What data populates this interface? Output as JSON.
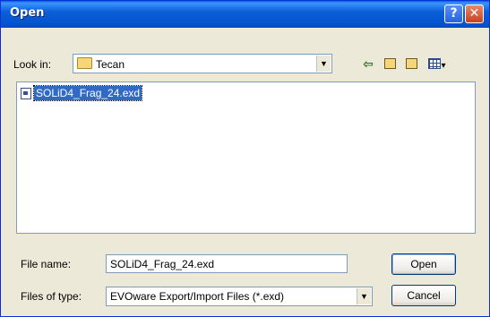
{
  "window": {
    "title": "Open",
    "help_glyph": "?",
    "close_glyph": "✕"
  },
  "look_in": {
    "label": "Look in:",
    "value": "Tecan",
    "icon": "folder-icon"
  },
  "toolbar": {
    "back_glyph": "⇦",
    "view_menu_glyph": "▾"
  },
  "files": [
    {
      "name": "SOLiD4_Frag_24.exd",
      "icon": "exd-file-icon",
      "selected": true
    }
  ],
  "file_name": {
    "label": "File name:",
    "value": "SOLiD4_Frag_24.exd"
  },
  "file_type": {
    "label": "Files of type:",
    "value": "EVOware Export/Import Files (*.exd)"
  },
  "buttons": {
    "open": "Open",
    "cancel": "Cancel"
  },
  "colors": {
    "selection": "#316ac5",
    "titlebar": "#0a5fd8"
  }
}
